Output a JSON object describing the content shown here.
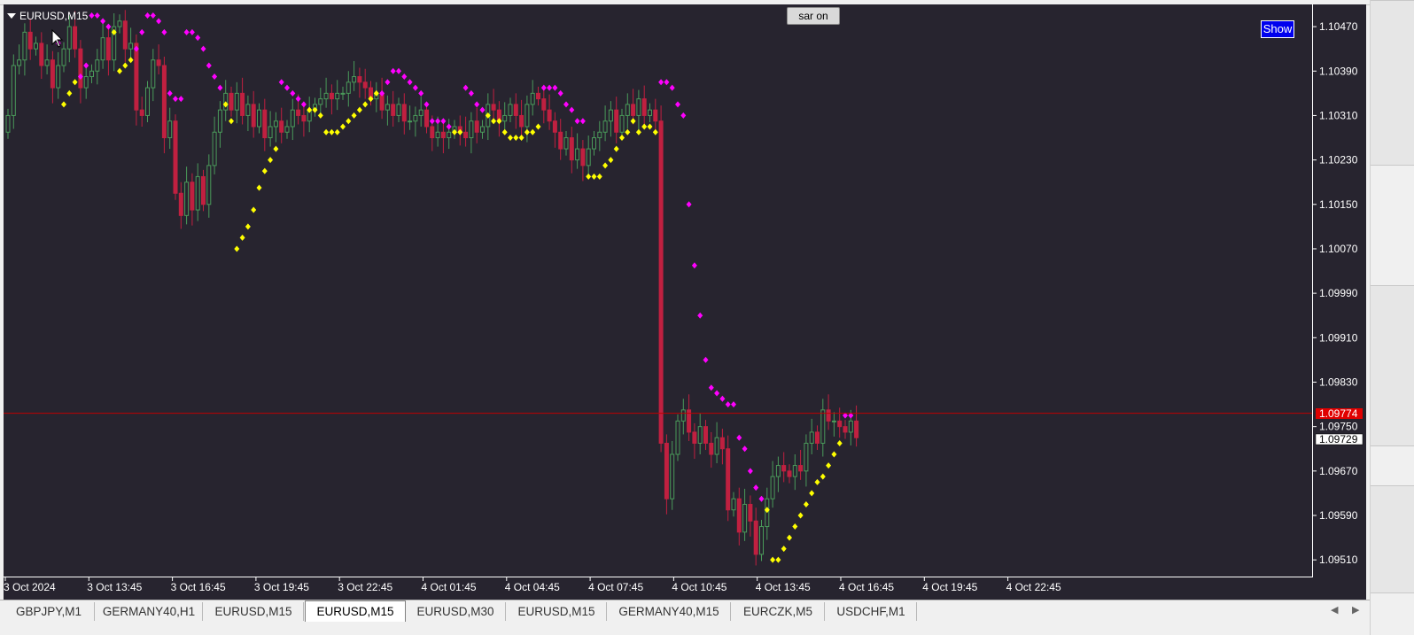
{
  "window": {
    "symbol_title": "EURUSD,M15"
  },
  "buttons": {
    "sar_label": "sar on",
    "show_label": "Show"
  },
  "colors": {
    "background": "#27242f",
    "bull_candle": "#4a9a5a",
    "bear_candle": "#c02040",
    "sar_above": "#ff00ff",
    "sar_below": "#ffff00",
    "bid_line": "#c00000",
    "axis_text": "#ffffff"
  },
  "price_axis": {
    "labels": [
      "1.10470",
      "1.10390",
      "1.10310",
      "1.10230",
      "1.10150",
      "1.10070",
      "1.09990",
      "1.09910",
      "1.09830",
      "1.09750",
      "1.09670",
      "1.09590",
      "1.09510"
    ],
    "current_bid": "1.09774",
    "tag_2": "1.09729"
  },
  "time_axis": {
    "labels": [
      "3 Oct 2024",
      "3 Oct 13:45",
      "3 Oct 16:45",
      "3 Oct 19:45",
      "3 Oct 22:45",
      "4 Oct 01:45",
      "4 Oct 04:45",
      "4 Oct 07:45",
      "4 Oct 10:45",
      "4 Oct 13:45",
      "4 Oct 16:45",
      "4 Oct 19:45",
      "4 Oct 22:45"
    ]
  },
  "chart_data": {
    "type": "candlestick",
    "symbol": "EURUSD",
    "timeframe": "M15",
    "ylim": [
      1.0948,
      1.1051
    ],
    "current_price": 1.09774,
    "closes": [
      1.1031,
      1.104,
      1.1041,
      1.1046,
      1.1043,
      1.1044,
      1.104,
      1.1041,
      1.1036,
      1.104,
      1.1043,
      1.1047,
      1.1043,
      1.1036,
      1.1038,
      1.1039,
      1.1041,
      1.1045,
      1.1041,
      1.1047,
      1.1048,
      1.1043,
      1.1044,
      1.1032,
      1.1031,
      1.1036,
      1.1041,
      1.104,
      1.1027,
      1.103,
      1.1017,
      1.1013,
      1.1019,
      1.1014,
      1.102,
      1.1015,
      1.1022,
      1.1028,
      1.1032,
      1.1035,
      1.1032,
      1.1035,
      1.1031,
      1.1033,
      1.1029,
      1.1032,
      1.1027,
      1.1029,
      1.103,
      1.1028,
      1.1029,
      1.1032,
      1.1031,
      1.103,
      1.1032,
      1.1033,
      1.1034,
      1.1035,
      1.1034,
      1.1035,
      1.1035,
      1.1037,
      1.1038,
      1.1037,
      1.1036,
      1.1034,
      1.1035,
      1.1032,
      1.1033,
      1.1031,
      1.1033,
      1.103,
      1.103,
      1.1031,
      1.1032,
      1.1029,
      1.1027,
      1.1028,
      1.1027,
      1.1028,
      1.1029,
      1.1028,
      1.1027,
      1.103,
      1.1028,
      1.1029,
      1.1033,
      1.1032,
      1.103,
      1.1031,
      1.1033,
      1.1031,
      1.1029,
      1.1033,
      1.1035,
      1.1034,
      1.1032,
      1.103,
      1.1028,
      1.1025,
      1.1027,
      1.1023,
      1.1025,
      1.1022,
      1.1025,
      1.1027,
      1.1028,
      1.103,
      1.1032,
      1.1028,
      1.1031,
      1.1033,
      1.1031,
      1.1034,
      1.1031,
      1.1032,
      1.103,
      1.0972,
      1.0962,
      1.097,
      1.0976,
      1.0978,
      1.0974,
      1.0972,
      1.0975,
      1.0972,
      1.097,
      1.0973,
      1.0971,
      1.096,
      1.0962,
      1.0956,
      1.0961,
      1.0958,
      1.0952,
      1.0957,
      1.0962,
      1.0966,
      1.0968,
      1.0967,
      1.0966,
      1.0968,
      1.0967,
      1.0972,
      1.0974,
      1.0972,
      1.0978,
      1.0976,
      1.0976,
      1.0975,
      1.0974,
      1.0976,
      1.0973
    ],
    "sar": [
      1.1044,
      1.1033,
      1.1035,
      1.1037,
      1.1038,
      1.104,
      1.1049,
      1.1049,
      1.1048,
      1.1047,
      1.1046,
      1.1039,
      1.104,
      1.1041,
      1.1043,
      1.1046,
      1.1049,
      1.1049,
      1.1048,
      1.1046,
      1.1035,
      1.1034,
      1.1034,
      1.1046,
      1.1046,
      1.1045,
      1.1043,
      1.104,
      1.1038,
      1.1036,
      1.1033,
      1.103,
      1.1007,
      1.1009,
      1.1011,
      1.1014,
      1.1018,
      1.1021,
      1.1023,
      1.1025,
      1.1037,
      1.1036,
      1.1035,
      1.1034,
      1.1033,
      1.1032,
      1.1032,
      1.1031,
      1.1028,
      1.1028,
      1.1028,
      1.1029,
      1.103,
      1.1031,
      1.1032,
      1.1033,
      1.1034,
      1.1035,
      1.1035,
      1.1037,
      1.1039,
      1.1039,
      1.1038,
      1.1037,
      1.1036,
      1.1035,
      1.1033,
      1.103,
      1.103,
      1.103,
      1.1029,
      1.1028,
      1.1028,
      1.1036,
      1.1035,
      1.1033,
      1.1032,
      1.1031,
      1.103,
      1.103,
      1.1028,
      1.1027,
      1.1027,
      1.1027,
      1.1028,
      1.1028,
      1.1029,
      1.1036,
      1.1036,
      1.1036,
      1.1035,
      1.1033,
      1.1032,
      1.103,
      1.103,
      1.102,
      1.102,
      1.102,
      1.1022,
      1.1023,
      1.1025,
      1.1027,
      1.1028,
      1.103,
      1.1028,
      1.1029,
      1.1029,
      1.1028,
      1.1037,
      1.1037,
      1.1036,
      1.1033,
      1.1031,
      1.1015,
      1.1004,
      1.0995,
      1.0987,
      1.0982,
      1.0981,
      1.098,
      1.0979,
      1.0979,
      1.0973,
      1.0971,
      1.0967,
      1.0964,
      1.0962,
      1.096,
      1.0951,
      1.0951,
      1.0953,
      1.0955,
      1.0957,
      1.0959,
      1.0961,
      1.0963,
      1.0965,
      1.0966,
      1.0968,
      1.097,
      1.0972,
      1.0977,
      1.0977
    ],
    "sar_start_candle": 9,
    "xlabel": "",
    "ylabel": ""
  },
  "tabs": [
    {
      "label": "GBPJPY,M1",
      "active": false
    },
    {
      "label": "GERMANY40,H1",
      "active": false
    },
    {
      "label": "EURUSD,M15",
      "active": false
    },
    {
      "label": "EURUSD,M15",
      "active": true
    },
    {
      "label": "EURUSD,M30",
      "active": false
    },
    {
      "label": "EURUSD,M15",
      "active": false
    },
    {
      "label": "GERMANY40,M15",
      "active": false
    },
    {
      "label": "EURCZK,M5",
      "active": false
    },
    {
      "label": "USDCHF,M1",
      "active": false
    }
  ],
  "tab_scroll": {
    "left_icon": "arrow-left-icon",
    "right_icon": "arrow-right-icon"
  }
}
